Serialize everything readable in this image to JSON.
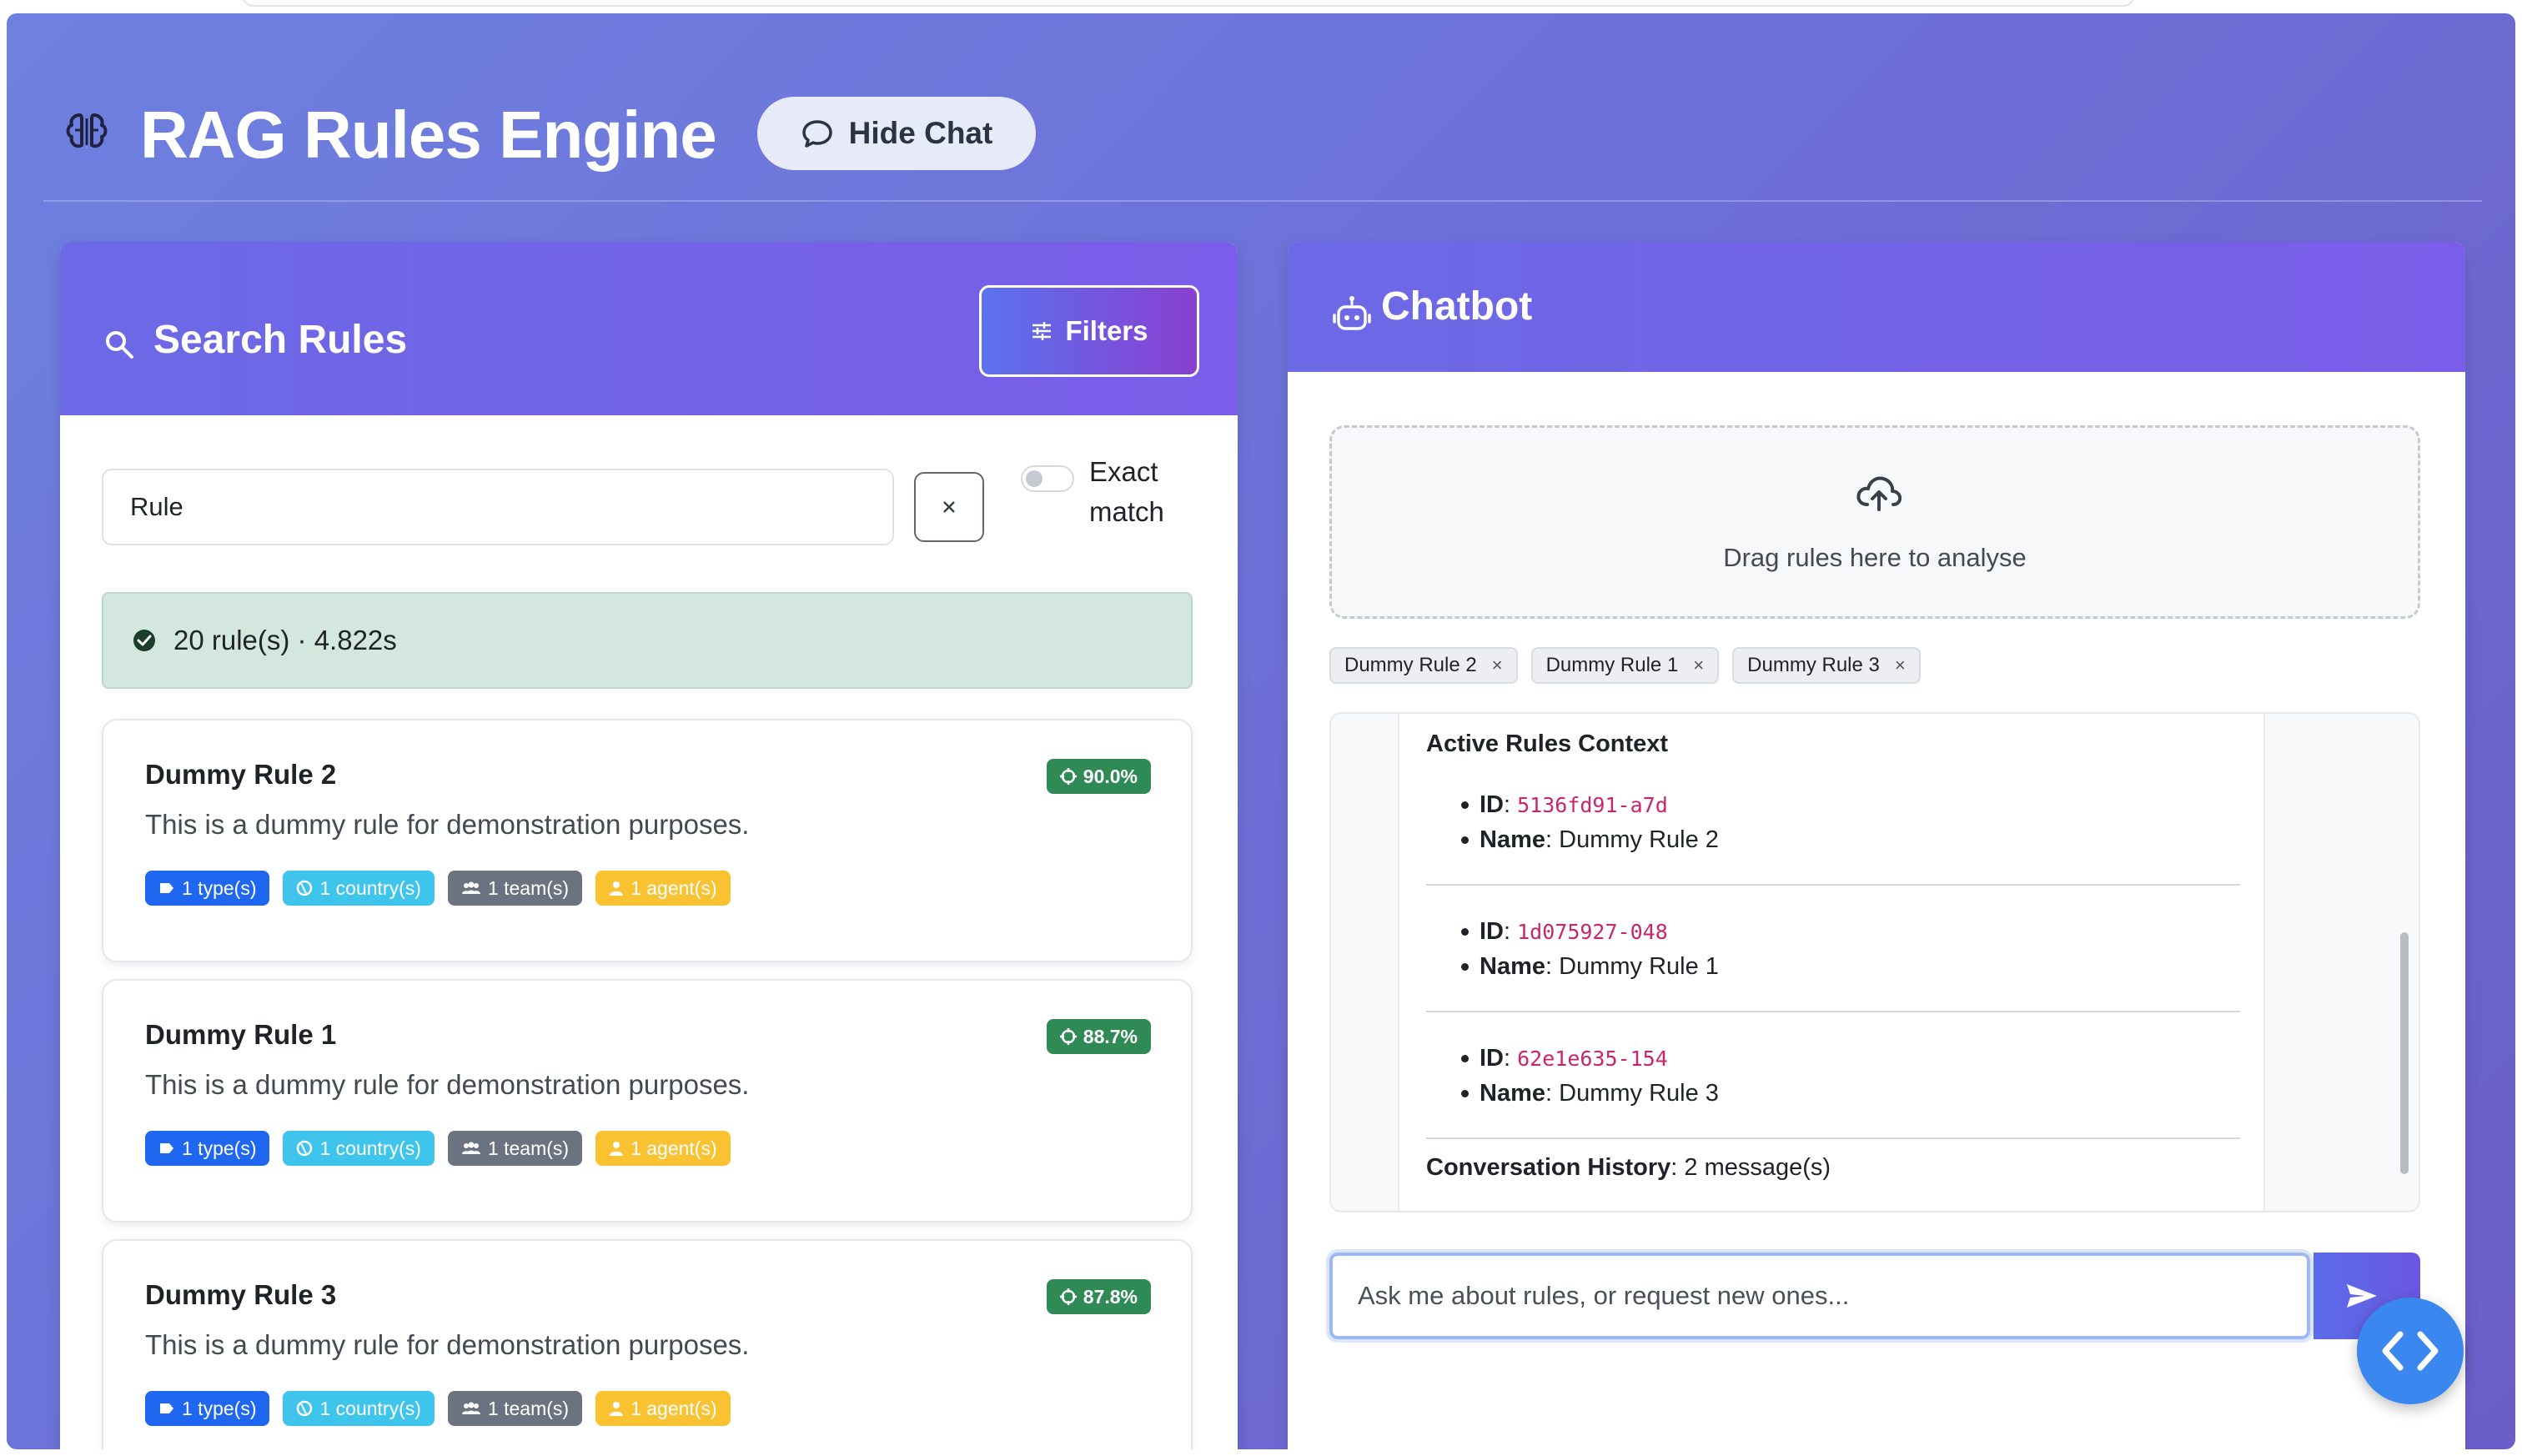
{
  "header": {
    "title": "RAG Rules Engine",
    "hide_chat_label": "Hide Chat"
  },
  "search_panel": {
    "title": "Search Rules",
    "filters_label": "Filters",
    "search_value": "Rule",
    "exact_match_label": "Exact match",
    "exact_match_enabled": false,
    "status_text": "20 rule(s) · 4.822s"
  },
  "rules": [
    {
      "name": "Dummy Rule 2",
      "description": "This is a dummy rule for demonstration purposes.",
      "score": "90.0%",
      "tags": {
        "type": "1 type(s)",
        "country": "1 country(s)",
        "team": "1 team(s)",
        "agent": "1 agent(s)"
      }
    },
    {
      "name": "Dummy Rule 1",
      "description": "This is a dummy rule for demonstration purposes.",
      "score": "88.7%",
      "tags": {
        "type": "1 type(s)",
        "country": "1 country(s)",
        "team": "1 team(s)",
        "agent": "1 agent(s)"
      }
    },
    {
      "name": "Dummy Rule 3",
      "description": "This is a dummy rule for demonstration purposes.",
      "score": "87.8%",
      "tags": {
        "type": "1 type(s)",
        "country": "1 country(s)",
        "team": "1 team(s)",
        "agent": "1 agent(s)"
      }
    }
  ],
  "chatbot": {
    "title": "Chatbot",
    "dropzone_text": "Drag rules here to analyse",
    "chips": [
      "Dummy Rule 2",
      "Dummy Rule 1",
      "Dummy Rule 3"
    ],
    "context": {
      "title": "Active Rules Context",
      "id_label": "ID",
      "name_label": "Name",
      "items": [
        {
          "id": "5136fd91-a7d",
          "name": "Dummy Rule 2"
        },
        {
          "id": "1d075927-048",
          "name": "Dummy Rule 1"
        },
        {
          "id": "62e1e635-154",
          "name": "Dummy Rule 3"
        }
      ],
      "history_label": "Conversation History",
      "history_value": "2 message(s)"
    },
    "input_placeholder": "Ask me about rules, or request new ones..."
  },
  "colors": {
    "background_gradient": [
      "#6e80e0",
      "#6c5ec8"
    ],
    "panel_header": "#6b69e6",
    "score_badge": "#2f8a55",
    "tag_type": "#1f66f0",
    "tag_country": "#3fc4ec",
    "tag_team": "#6b7280",
    "tag_agent": "#f8c231",
    "code_id": "#c7266d",
    "fab": "#3b87f0"
  },
  "icons": {
    "brand": "brain-icon",
    "hide_chat": "chat-bubble-icon",
    "search": "search-icon",
    "filters": "sliders-icon",
    "clear": "close-icon",
    "status": "check-circle-icon",
    "score": "target-icon",
    "tag_type": "label-icon",
    "tag_country": "globe-icon",
    "tag_team": "people-icon",
    "tag_agent": "person-icon",
    "chatbot": "robot-icon",
    "dropzone": "cloud-upload-icon",
    "send": "send-icon",
    "fab": "code-icon"
  }
}
